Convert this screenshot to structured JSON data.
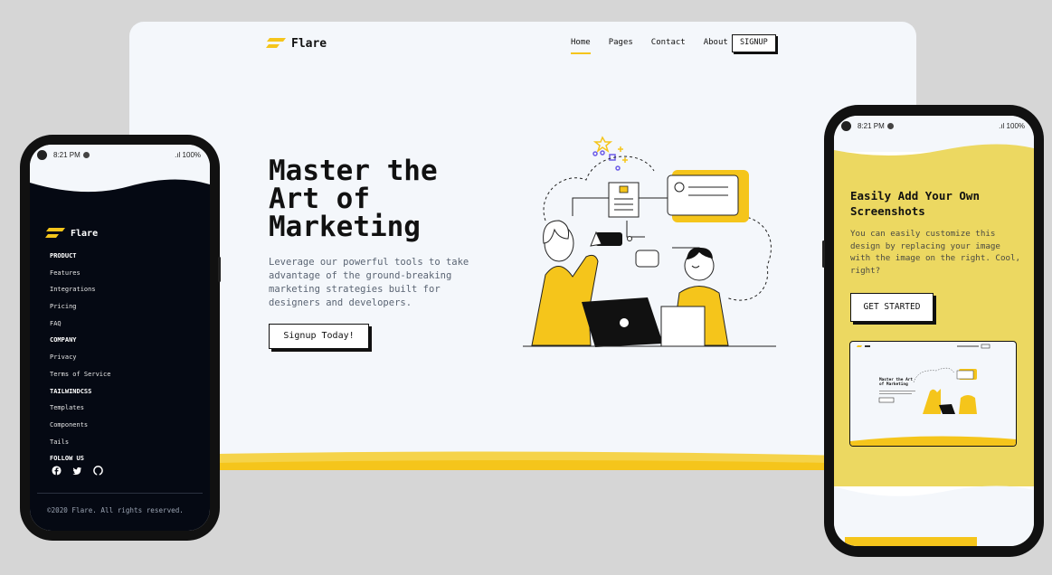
{
  "brand": {
    "name": "Flare",
    "accent": "#f5c51b",
    "dark": "#050913"
  },
  "desktop": {
    "nav": {
      "links": [
        "Home",
        "Pages",
        "Contact",
        "About"
      ],
      "signup": "SIGNUP"
    },
    "hero": {
      "title_lines": [
        "Master the",
        "Art of",
        "Marketing"
      ],
      "description": "Leverage our powerful tools to take advantage of the ground-breaking marketing strategies built for designers and developers.",
      "cta": "Signup Today!"
    }
  },
  "phone_left": {
    "status": {
      "time": "8:21 PM",
      "battery": ".ıl 100%"
    },
    "brand": "Flare",
    "footer_items": [
      {
        "label": "PRODUCT",
        "heading": true
      },
      {
        "label": "Features"
      },
      {
        "label": "Integrations"
      },
      {
        "label": "Pricing"
      },
      {
        "label": "FAQ"
      },
      {
        "label": "COMPANY",
        "heading": true
      },
      {
        "label": "Privacy"
      },
      {
        "label": "Terms of Service"
      },
      {
        "label": "TAILWINDCSS",
        "heading": true
      },
      {
        "label": "Templates"
      },
      {
        "label": "Components"
      },
      {
        "label": "Tails"
      },
      {
        "label": "FOLLOW US",
        "heading": true
      }
    ],
    "social_icons": [
      "facebook-icon",
      "twitter-icon",
      "github-icon"
    ],
    "copyright": "©2020 Flare. All rights reserved."
  },
  "phone_right": {
    "status": {
      "time": "8:21 PM",
      "battery": ".ıl 100%"
    },
    "title": "Easily Add Your Own Screenshots",
    "description": "You can easily customize this design by replacing your image with the image on the right. Cool, right?",
    "cta": "GET STARTED",
    "thumbnail_title": "Master the Art of Marketing"
  }
}
